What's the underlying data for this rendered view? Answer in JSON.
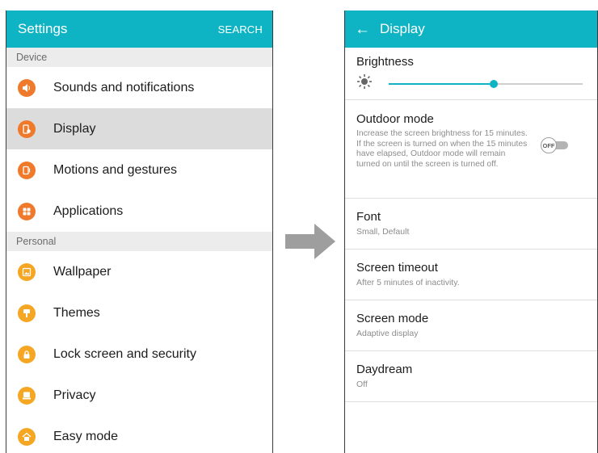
{
  "left_screen": {
    "title": "Settings",
    "search_label": "SEARCH",
    "sections": [
      {
        "header": "Device",
        "items": [
          {
            "label": "Sounds and notifications",
            "icon": "speaker-icon",
            "color": "#ef7a2b",
            "selected": false
          },
          {
            "label": "Display",
            "icon": "display-icon",
            "color": "#ef7a2b",
            "selected": true
          },
          {
            "label": "Motions and gestures",
            "icon": "motions-icon",
            "color": "#ef7a2b",
            "selected": false
          },
          {
            "label": "Applications",
            "icon": "apps-grid-icon",
            "color": "#ef7a2b",
            "selected": false
          }
        ]
      },
      {
        "header": "Personal",
        "items": [
          {
            "label": "Wallpaper",
            "icon": "wallpaper-icon",
            "color": "#f5a623",
            "selected": false
          },
          {
            "label": "Themes",
            "icon": "paintbrush-icon",
            "color": "#f5a623",
            "selected": false
          },
          {
            "label": "Lock screen and security",
            "icon": "lock-icon",
            "color": "#f5a623",
            "selected": false
          },
          {
            "label": "Privacy",
            "icon": "privacy-icon",
            "color": "#f5a623",
            "selected": false
          },
          {
            "label": "Easy mode",
            "icon": "home-icon",
            "color": "#f5a623",
            "selected": false
          }
        ]
      }
    ]
  },
  "right_screen": {
    "title": "Display",
    "brightness": {
      "title": "Brightness",
      "level": 0.54
    },
    "outdoor_mode": {
      "title": "Outdoor mode",
      "description": "Increase the screen brightness for 15 minutes. If the screen is turned on when the 15 minutes have elapsed, Outdoor mode will remain turned on until the screen is turned off.",
      "toggle_label": "OFF"
    },
    "font": {
      "title": "Font",
      "value": "Small, Default"
    },
    "screen_timeout": {
      "title": "Screen timeout",
      "value": "After 5 minutes of inactivity."
    },
    "screen_mode": {
      "title": "Screen mode",
      "value": "Adaptive display"
    },
    "daydream": {
      "title": "Daydream",
      "value": "Off"
    }
  },
  "colors": {
    "accent": "#0fb4c4",
    "device_icon": "#ef7a2b",
    "personal_icon": "#f5a623",
    "arrow": "#9e9e9e"
  }
}
